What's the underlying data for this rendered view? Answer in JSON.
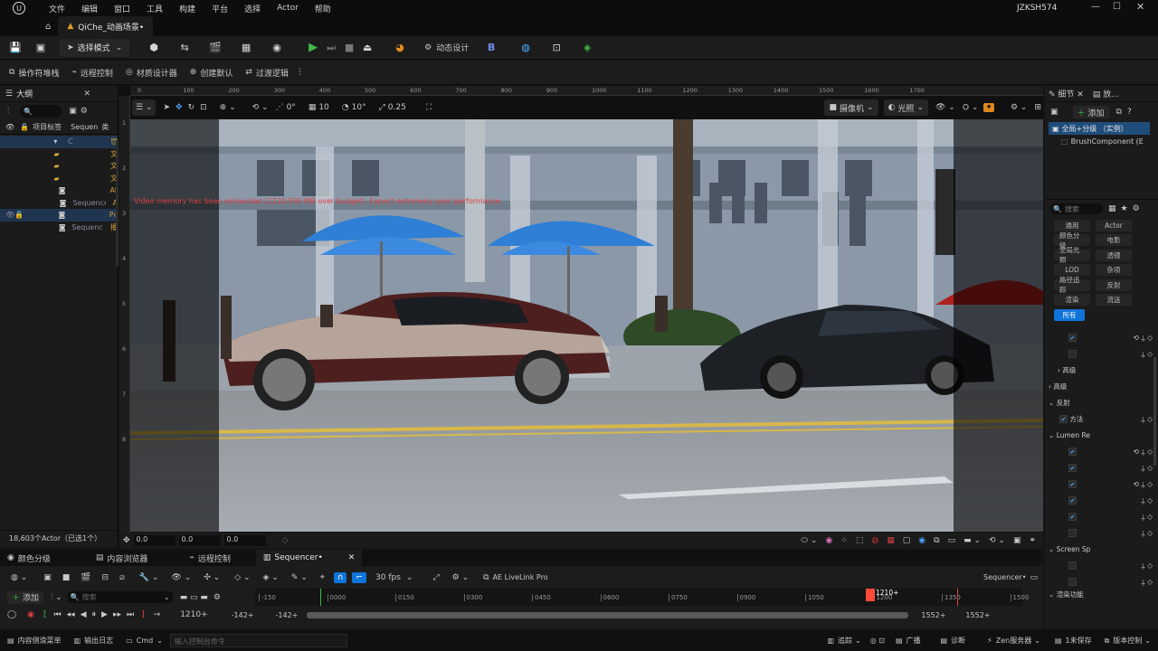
{
  "titlebar": {
    "menus": [
      "文件",
      "编辑",
      "窗口",
      "工具",
      "构建",
      "平台",
      "选择",
      "Actor",
      "帮助"
    ],
    "user": "JZKSH574"
  },
  "tab": {
    "label": "QiChe_动画场景•"
  },
  "toolbar1": {
    "mode": "选择模式",
    "dynamic_design": "动态设计"
  },
  "toolbar2": {
    "items": [
      "操作符堆栈",
      "远程控制",
      "材质设计器",
      "创建默认",
      "过渡逻辑"
    ]
  },
  "outliner": {
    "title": "大纲",
    "col_label": "项目标签",
    "col_type": "类",
    "seq_label": "Sequen",
    "rows": [
      {
        "a": "",
        "b": "C",
        "c": "世"
      },
      {
        "a": "",
        "b": "",
        "c": "文"
      },
      {
        "a": "",
        "b": "",
        "c": "文"
      },
      {
        "a": "",
        "b": "",
        "c": "文"
      },
      {
        "a": "",
        "b": "",
        "c": "At"
      },
      {
        "a": "",
        "b": "Sequence",
        "c": "A"
      },
      {
        "a": "",
        "b": "",
        "c": "Pc"
      },
      {
        "a": "",
        "b": "Sequence",
        "c": "播"
      }
    ],
    "footer": "18,603个Actor（已选1个）"
  },
  "viewport": {
    "top_ruler": [
      "0",
      "100",
      "200",
      "300",
      "400",
      "500",
      "600",
      "700",
      "800",
      "900",
      "1000",
      "1100",
      "1200",
      "1300",
      "1400",
      "1500",
      "1600",
      "1700"
    ],
    "side_ruler": [
      "1",
      "2",
      "3",
      "4",
      "5",
      "6",
      "7",
      "8"
    ],
    "warning": "Video memory has been exhausted (2220.595 MB over budget). Expect extremely poor performance.",
    "snap_angle": "0°",
    "grid": "10",
    "rot": "10°",
    "scale": "0.25",
    "camera": "摄像机",
    "lighting": "光照",
    "bottom_fields": [
      "0.0",
      "0.0",
      "0.0"
    ]
  },
  "details": {
    "tab1": "细节",
    "tab2": "放...",
    "add": "添加",
    "selected": "全局+分级 （实例）",
    "component": "BrushComponent (E",
    "search": "搜索",
    "filters": [
      [
        "通用",
        "Actor"
      ],
      [
        "颜色分级",
        "电影"
      ],
      [
        "全局光照",
        "透镜"
      ],
      [
        "LOD",
        "杂项"
      ],
      [
        "路径追踪",
        "反射"
      ],
      [
        "渲染",
        "流送"
      ],
      [
        "所有",
        ""
      ]
    ],
    "sections": {
      "advanced1": "高级",
      "advanced2": "高级",
      "reflection": "反射",
      "method": "方法",
      "lumen": "Lumen Re",
      "screen": "Screen Sp",
      "render": "渲染功能"
    }
  },
  "bottom_tabs": [
    "颜色分级",
    "内容浏览器",
    "远程控制",
    "Sequencer•"
  ],
  "sequencer": {
    "fps": "30 fps",
    "liveLink": "AE LiveLink Pro",
    "name": "Sequencer•",
    "add": "添加",
    "search": "搜索",
    "ticks": [
      "-150",
      "0000",
      "0150",
      "0300",
      "0450",
      "0600",
      "0750",
      "0900",
      "1050",
      "1200",
      "1350",
      "1500"
    ],
    "current": "1210+",
    "frame_field": "1210+",
    "start1": "-142+",
    "start2": "-142+",
    "end1": "1552+",
    "end2": "1552+"
  },
  "statusbar": {
    "items": [
      "内容侧滑菜单",
      "输出日志",
      "Cmd",
      "输入控制台命令",
      "追踪",
      "广播",
      "诊断",
      "Zen服务器",
      "1未保存",
      "版本控制"
    ]
  },
  "colors": {
    "accent": "#0f74d9",
    "play": "#3dbb45",
    "orange": "#e08a1e",
    "playhead": "#ff4a3a"
  }
}
